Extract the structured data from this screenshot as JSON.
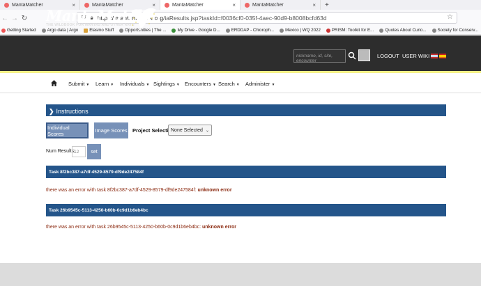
{
  "browser": {
    "tabs": [
      {
        "label": "MantaMatcher",
        "active": false
      },
      {
        "label": "MantaMatcher",
        "active": false
      },
      {
        "label": "MantaMatcher",
        "active": true
      },
      {
        "label": "MantaMatcher",
        "active": false
      }
    ],
    "url_domain": "https://mantamatcher.org",
    "url_path": "/iaResults.jsp?taskId=f0036cf0-035f-4aec-90d9-b8008bcfd63d",
    "bookmarks": [
      "Getting Started",
      "Argo data | Argo",
      "Elasmo Stuff",
      "Opportunities | The ...",
      "My Drive - Google D...",
      "ERDDAP - Chloroph...",
      "Mexico | WQ 2022",
      "PRISM: Toolkit for E...",
      "Quotes About Curio...",
      "Society for Conserv..."
    ]
  },
  "header": {
    "logo": "MantaMatcher",
    "tagline": "THE WILDBOOK FOR MANTAS AND OTHER RAYS",
    "search_placeholder": "nickname, id, site, encounter",
    "logout": "LOGOUT",
    "user_wiki": "USER WIKI"
  },
  "nav": {
    "items": [
      "Submit",
      "Learn",
      "Individuals",
      "Sightings",
      "Encounters",
      "Search",
      "Administer"
    ]
  },
  "main": {
    "instructions": "Instructions",
    "individual_scores": "Individual Scores",
    "image_scores": "Image Scores",
    "project_selection_label": "Project Selection",
    "project_selected": "None Selected",
    "num_results_label": "Num Results:",
    "num_results_placeholder": "12",
    "set_label": "set",
    "tasks": [
      {
        "title": "Task 8f2bc387-a7df-4529-8579-df9de247584f",
        "error_prefix": "there was an error with task 8f2bc387-a7df-4529-8579-df9de247584f:",
        "error_strong": "unknown error"
      },
      {
        "title": "Task 26b9545c-5113-4250-b60b-0c9d1b6eb4bc",
        "error_prefix": "there was an error with task 26b9545c-5113-4250-b60b-0c9d1b6eb4bc:",
        "error_strong": "unknown error"
      }
    ]
  },
  "colors": {
    "header_bg": "#2d2d2d",
    "primary_blue": "#24558a",
    "button_blue": "#7791b8",
    "error_text": "#8b2a10",
    "accent_line": "#f5f188"
  }
}
